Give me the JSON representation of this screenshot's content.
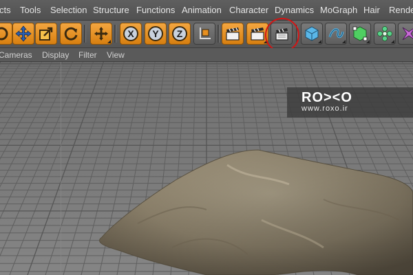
{
  "menubar": {
    "items": [
      "cts",
      "Tools",
      "Selection",
      "Structure",
      "Functions",
      "Animation",
      "Character",
      "Dynamics",
      "MoGraph",
      "Hair",
      "Render"
    ]
  },
  "toolbar": {
    "buttons": [
      {
        "icon": "rotate-partial-icon"
      },
      {
        "icon": "move-icon"
      },
      {
        "icon": "scale-icon"
      },
      {
        "icon": "rotate-icon"
      },
      {
        "icon": "live-selection-move-icon"
      },
      {
        "icon": "x-axis-lock-icon"
      },
      {
        "icon": "y-axis-lock-icon"
      },
      {
        "icon": "z-axis-lock-icon"
      },
      {
        "icon": "coordinate-system-icon"
      },
      {
        "icon": "render-view-icon"
      },
      {
        "icon": "render-picture-viewer-icon"
      },
      {
        "icon": "edit-render-settings-icon"
      },
      {
        "icon": "cube-icon"
      },
      {
        "icon": "spline-icon"
      },
      {
        "icon": "nurbs-icon"
      },
      {
        "icon": "array-icon"
      },
      {
        "icon": "deformer-icon"
      }
    ],
    "axis_labels": {
      "x": "X",
      "y": "Y",
      "z": "Z"
    }
  },
  "viewmenu": {
    "items": [
      "Cameras",
      "Display",
      "Filter",
      "View"
    ]
  },
  "watermark": {
    "logo": "RO><O",
    "url": "www.roxo.ir"
  },
  "colors": {
    "accent_orange": "#e8901f",
    "highlight_red": "#d41414",
    "pillow": "#9c907a",
    "floor_grid": "#7d7d7d"
  }
}
